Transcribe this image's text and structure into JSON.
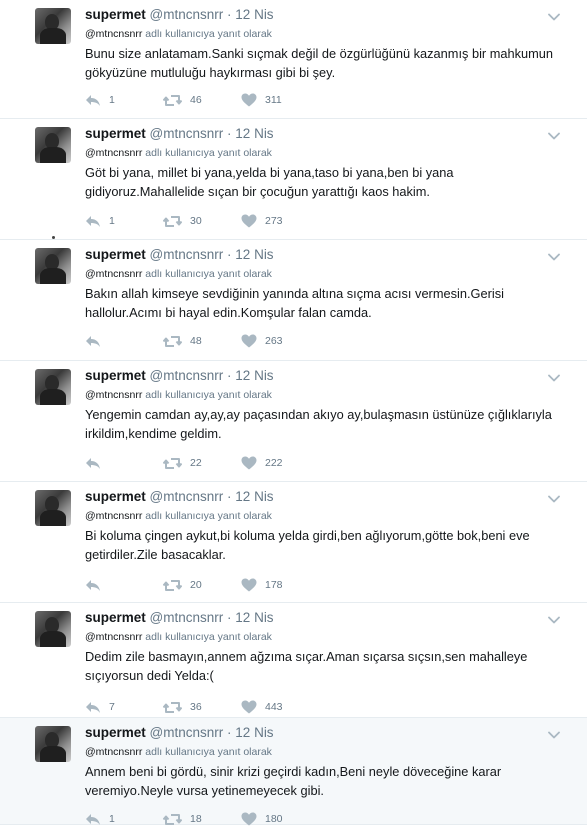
{
  "tweets": [
    {
      "name": "supermet",
      "handle": "@mtncnsnrr",
      "dot": "·",
      "date": "12 Nis",
      "reply_handle": "@mtncnsnrr",
      "reply_suffix": "adlı kullanıcıya yanıt olarak",
      "text": "Bunu size anlatamam.Sanki sıçmak değil de özgürlüğünü kazanmış bir mahkumun gökyüzüne mutluluğu haykırması gibi bi şey.",
      "replies": "1",
      "retweets": "46",
      "likes": "311",
      "highlighted": false
    },
    {
      "name": "supermet",
      "handle": "@mtncnsnrr",
      "dot": "·",
      "date": "12 Nis",
      "reply_handle": "@mtncnsnrr",
      "reply_suffix": "adlı kullanıcıya yanıt olarak",
      "text": "Göt bi yana, millet bi yana,yelda bi yana,taso bi yana,ben bi yana gidiyoruz.Mahallelide sıçan bir çocuğun yarattığı kaos hakim.",
      "replies": "1",
      "retweets": "30",
      "likes": "273",
      "highlighted": false
    },
    {
      "name": "supermet",
      "handle": "@mtncnsnrr",
      "dot": "·",
      "date": "12 Nis",
      "reply_handle": "@mtncnsnrr",
      "reply_suffix": "adlı kullanıcıya yanıt olarak",
      "text": "Bakın allah kimseye sevdiğinin yanında altına sıçma acısı vermesin.Gerisi hallolur.Acımı bi hayal edin.Komşular falan camda.",
      "replies": "",
      "retweets": "48",
      "likes": "263",
      "highlighted": false
    },
    {
      "name": "supermet",
      "handle": "@mtncnsnrr",
      "dot": "·",
      "date": "12 Nis",
      "reply_handle": "@mtncnsnrr",
      "reply_suffix": "adlı kullanıcıya yanıt olarak",
      "text": "Yengemin camdan ay,ay,ay paçasından akıyo ay,bulaşmasın üstünüze çığlıklarıyla irkildim,kendime geldim.",
      "replies": "",
      "retweets": "22",
      "likes": "222",
      "highlighted": false
    },
    {
      "name": "supermet",
      "handle": "@mtncnsnrr",
      "dot": "·",
      "date": "12 Nis",
      "reply_handle": "@mtncnsnrr",
      "reply_suffix": "adlı kullanıcıya yanıt olarak",
      "text": "Bi koluma çingen aykut,bi koluma yelda girdi,ben ağlıyorum,götte bok,beni eve getirdiler.Zile basacaklar.",
      "replies": "",
      "retweets": "20",
      "likes": "178",
      "highlighted": false
    },
    {
      "name": "supermet",
      "handle": "@mtncnsnrr",
      "dot": "·",
      "date": "12 Nis",
      "reply_handle": "@mtncnsnrr",
      "reply_suffix": "adlı kullanıcıya yanıt olarak",
      "text": "Dedim zile basmayın,annem ağzıma sıçar.Aman sıçarsa sıçsın,sen mahalleye sıçıyorsun dedi Yelda:(",
      "replies": "7",
      "retweets": "36",
      "likes": "443",
      "highlighted": false
    },
    {
      "name": "supermet",
      "handle": "@mtncnsnrr",
      "dot": "·",
      "date": "12 Nis",
      "reply_handle": "@mtncnsnrr",
      "reply_suffix": "adlı kullanıcıya yanıt olarak",
      "text": "Annem beni bi gördü, sinir krizi geçirdi kadın,Beni neyle döveceğine karar veremiyo.Neyle vursa yetinemeyecek gibi.",
      "replies": "1",
      "retweets": "18",
      "likes": "180",
      "highlighted": true
    }
  ],
  "colors": {
    "text": "#14171a",
    "muted": "#657786",
    "icon": "#aab8c2",
    "divider": "#e6ecf0",
    "highlight_bg": "#f5f8fa"
  },
  "icons": {
    "reply": "reply-icon",
    "retweet": "retweet-icon",
    "like": "heart-icon",
    "caret": "chevron-down-icon"
  }
}
